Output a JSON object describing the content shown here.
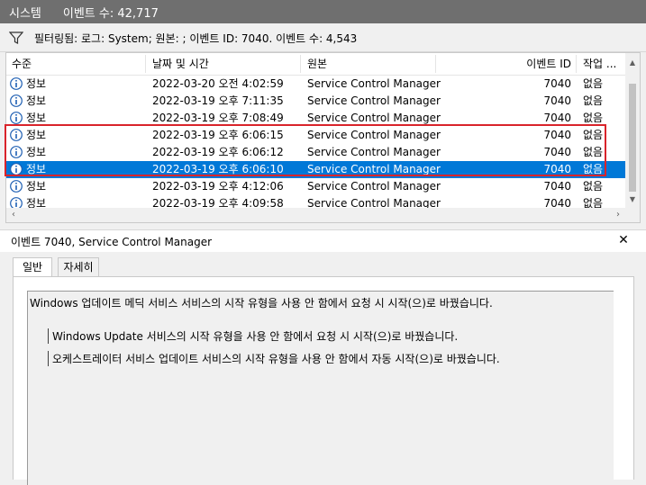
{
  "title": {
    "log_name": "시스템",
    "event_count": "이벤트 수: 42,717"
  },
  "filter": {
    "text": "필터링됨: 로그: System; 원본: ; 이벤트 ID: 7040. 이벤트 수: 4,543"
  },
  "columns": {
    "level": "수준",
    "datetime": "날짜 및 시간",
    "source": "원본",
    "event_id": "이벤트 ID",
    "task": "작업 ..."
  },
  "rows": [
    {
      "level": "정보",
      "datetime": "2022-03-20 오전 4:02:59",
      "source": "Service Control Manager",
      "event_id": "7040",
      "task": "없음"
    },
    {
      "level": "정보",
      "datetime": "2022-03-19 오후 7:11:35",
      "source": "Service Control Manager",
      "event_id": "7040",
      "task": "없음"
    },
    {
      "level": "정보",
      "datetime": "2022-03-19 오후 7:08:49",
      "source": "Service Control Manager",
      "event_id": "7040",
      "task": "없음"
    },
    {
      "level": "정보",
      "datetime": "2022-03-19 오후 6:06:15",
      "source": "Service Control Manager",
      "event_id": "7040",
      "task": "없음"
    },
    {
      "level": "정보",
      "datetime": "2022-03-19 오후 6:06:12",
      "source": "Service Control Manager",
      "event_id": "7040",
      "task": "없음"
    },
    {
      "level": "정보",
      "datetime": "2022-03-19 오후 6:06:10",
      "source": "Service Control Manager",
      "event_id": "7040",
      "task": "없음"
    },
    {
      "level": "정보",
      "datetime": "2022-03-19 오후 4:12:06",
      "source": "Service Control Manager",
      "event_id": "7040",
      "task": "없음"
    },
    {
      "level": "정보",
      "datetime": "2022-03-19 오후 4:09:58",
      "source": "Service Control Manager",
      "event_id": "7040",
      "task": "없음"
    }
  ],
  "detail": {
    "title": "이벤트 7040, Service Control Manager",
    "tabs": [
      "일반",
      "자세히"
    ],
    "description": [
      "Windows 업데이트 메딕 서비스 서비스의 시작 유형을 사용 안 함에서 요청 시 시작(으)로 바꿨습니다.",
      "Windows Update 서비스의 시작 유형을 사용 안 함에서 요청 시 시작(으)로 바꿨습니다.",
      "오케스트레이터 서비스 업데이트 서비스의 시작 유형을 사용 안 함에서 자동 시작(으)로 바꿨습니다."
    ]
  },
  "icons": {
    "info": "info-icon",
    "filter": "filter-icon",
    "close": "close-icon"
  },
  "colors": {
    "selection": "#0078d7",
    "highlight_border": "#d9242b",
    "info_icon": "#1e5fb3",
    "title_bar": "#6f6f6f"
  }
}
